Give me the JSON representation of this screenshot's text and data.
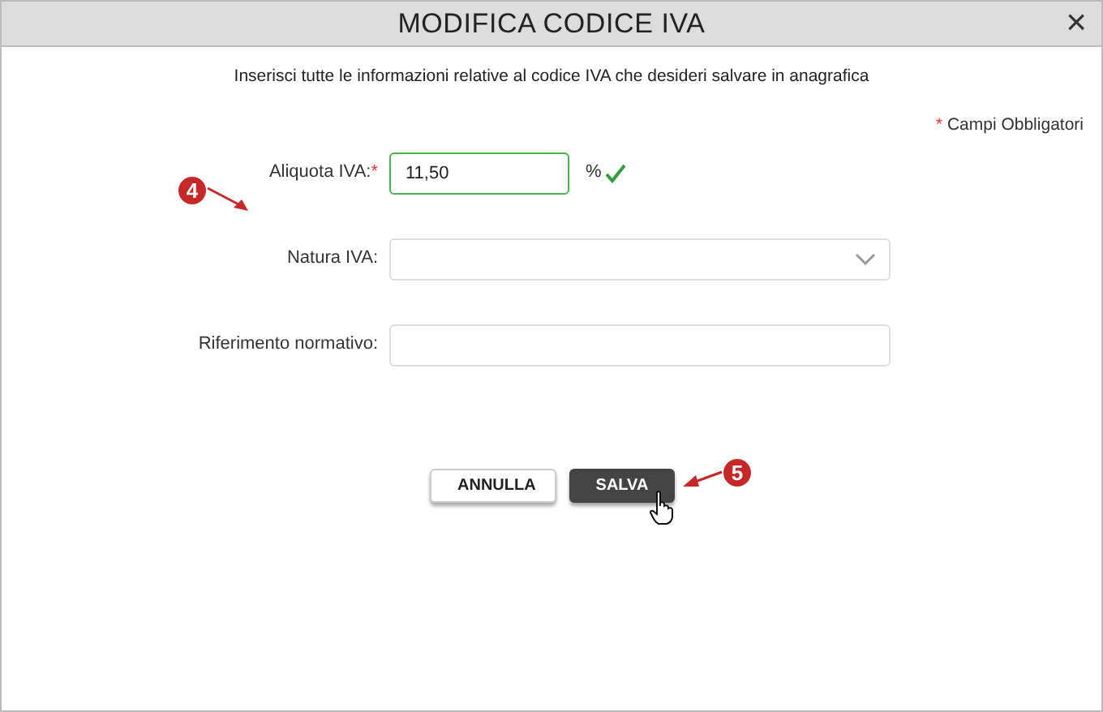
{
  "window": {
    "title": "MODIFICA CODICE IVA",
    "close": "×"
  },
  "intro": "Inserisci tutte le informazioni relative al codice IVA che desideri salvare in anagrafica",
  "required_note": {
    "mark": "*",
    "text": "Campi Obbligatori"
  },
  "fields": [
    {
      "kind": "text",
      "label": "Aliquota IVA:",
      "required": true,
      "value": "11,50",
      "suffix": "%",
      "valid": true
    },
    {
      "kind": "select",
      "label": "Natura IVA:",
      "required": false
    },
    {
      "kind": "wide",
      "label": "Riferimento normativo:",
      "required": false
    }
  ],
  "buttons": [
    {
      "label": "ANNULLA",
      "primary": false
    },
    {
      "label": "SALVA",
      "primary": true
    }
  ],
  "annotations": [
    {
      "number": "4"
    },
    {
      "number": "5"
    }
  ]
}
